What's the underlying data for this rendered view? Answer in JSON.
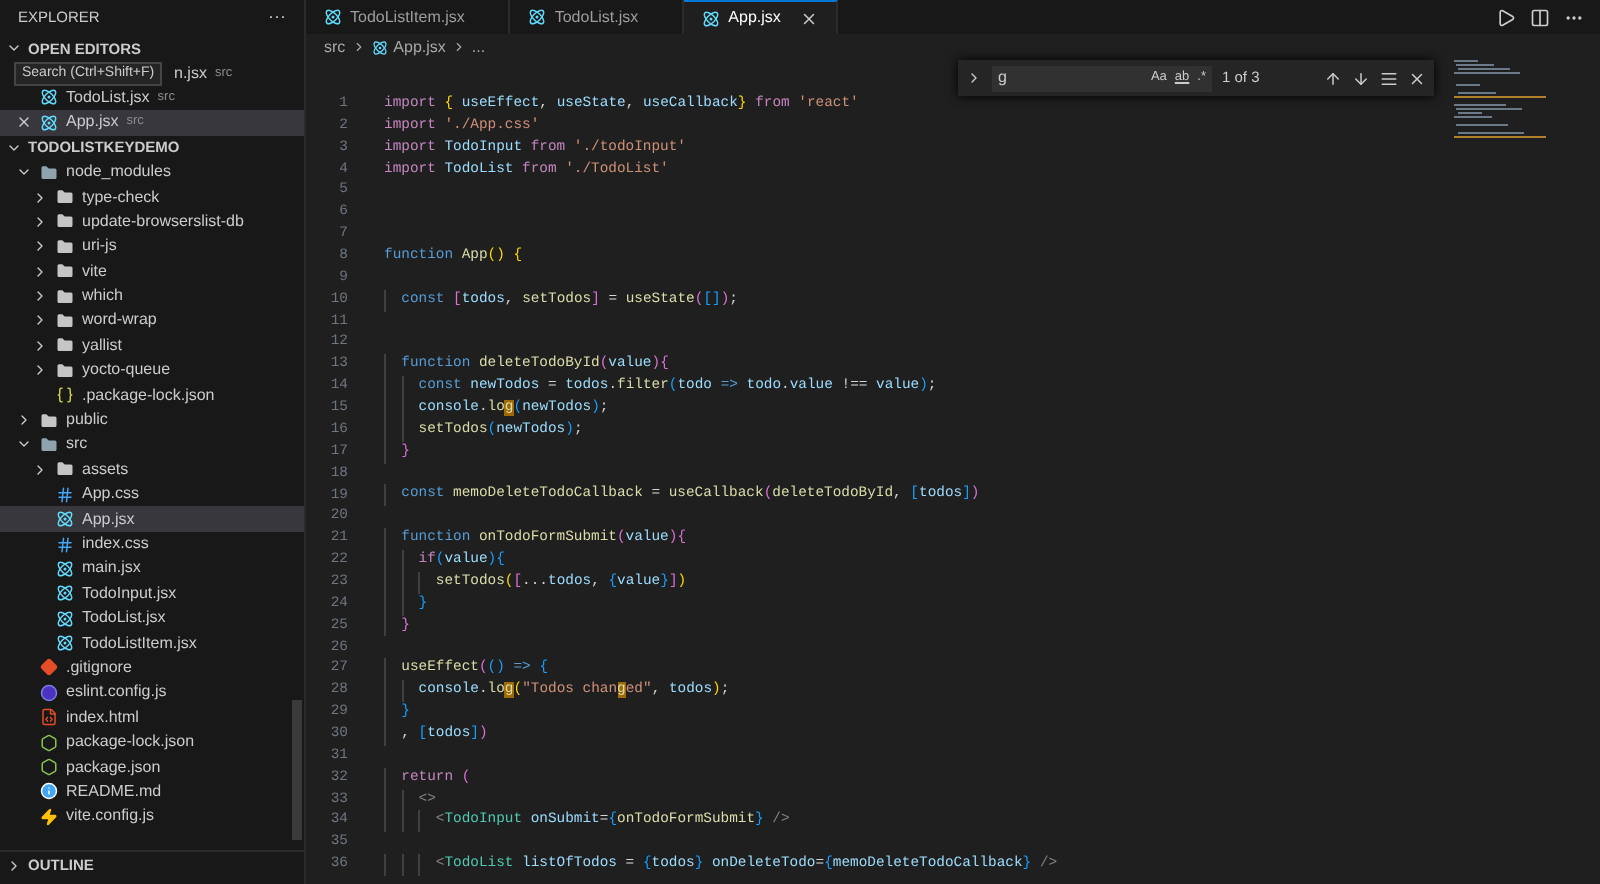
{
  "sidebar": {
    "title": "EXPLORER",
    "more": "···",
    "open_editors": {
      "title": "OPEN EDITORS",
      "expanded": true,
      "tooltip": "Search (Ctrl+Shift+F)",
      "items": [
        {
          "name": "n.jsx",
          "detail": "src",
          "selected": false,
          "partial": true
        },
        {
          "name": "TodoList.jsx",
          "detail": "src",
          "kind": "react",
          "selected": false,
          "partial": false
        },
        {
          "name": "App.jsx",
          "detail": "src",
          "kind": "react",
          "selected": true,
          "partial": false
        }
      ]
    },
    "project": {
      "title": "TODOLISTKEYDEMO",
      "expanded": true,
      "items": [
        {
          "name": "node_modules",
          "kind": "folder",
          "expanded": true,
          "selected": false,
          "children": [
            {
              "name": "type-check",
              "kind": "folder",
              "expanded": false,
              "selected": false
            },
            {
              "name": "update-browserslist-db",
              "kind": "folder",
              "expanded": false,
              "selected": false
            },
            {
              "name": "uri-js",
              "kind": "folder",
              "expanded": false,
              "selected": false
            },
            {
              "name": "vite",
              "kind": "folder",
              "expanded": false,
              "selected": false
            },
            {
              "name": "which",
              "kind": "folder",
              "expanded": false,
              "selected": false
            },
            {
              "name": "word-wrap",
              "kind": "folder",
              "expanded": false,
              "selected": false
            },
            {
              "name": "yallist",
              "kind": "folder",
              "expanded": false,
              "selected": false
            },
            {
              "name": "yocto-queue",
              "kind": "folder",
              "expanded": false,
              "selected": false
            },
            {
              "name": ".package-lock.json",
              "kind": "json",
              "selected": false
            }
          ]
        },
        {
          "name": "public",
          "kind": "folder",
          "expanded": false,
          "selected": false
        },
        {
          "name": "src",
          "kind": "folder",
          "expanded": true,
          "selected": false,
          "children": [
            {
              "name": "assets",
              "kind": "folder",
              "expanded": false,
              "selected": false
            },
            {
              "name": "App.css",
              "kind": "css",
              "selected": false
            },
            {
              "name": "App.jsx",
              "kind": "react",
              "selected": true
            },
            {
              "name": "index.css",
              "kind": "css",
              "selected": false
            },
            {
              "name": "main.jsx",
              "kind": "react",
              "selected": false
            },
            {
              "name": "TodoInput.jsx",
              "kind": "react",
              "selected": false
            },
            {
              "name": "TodoList.jsx",
              "kind": "react",
              "selected": false
            },
            {
              "name": "TodoListItem.jsx",
              "kind": "react",
              "selected": false
            }
          ]
        },
        {
          "name": ".gitignore",
          "kind": "git",
          "selected": false
        },
        {
          "name": "eslint.config.js",
          "kind": "eslint",
          "selected": false
        },
        {
          "name": "index.html",
          "kind": "html",
          "selected": false
        },
        {
          "name": "package-lock.json",
          "kind": "npm",
          "selected": false
        },
        {
          "name": "package.json",
          "kind": "npm",
          "selected": false
        },
        {
          "name": "README.md",
          "kind": "info",
          "selected": false
        },
        {
          "name": "vite.config.js",
          "kind": "vite",
          "selected": false
        }
      ]
    },
    "outline": {
      "title": "OUTLINE",
      "expanded": false
    }
  },
  "tabs": [
    {
      "label": "TodoListItem.jsx",
      "selected": false
    },
    {
      "label": "TodoList.jsx",
      "selected": false
    },
    {
      "label": "App.jsx",
      "selected": true
    }
  ],
  "breadcrumb": [
    "src",
    "App.jsx",
    "..."
  ],
  "find": {
    "value": "g",
    "options": [
      "Aa",
      "ab",
      ".*"
    ],
    "result": "1 of 3"
  },
  "code": [
    {
      "number": "1",
      "tokens": [
        {
          "text": "import ",
          "kind": "kw"
        },
        {
          "text": "{",
          "kind": "b1"
        },
        {
          "text": " useEffect",
          "kind": "var"
        },
        {
          "text": ", ",
          "kind": "p"
        },
        {
          "text": "useState",
          "kind": "var"
        },
        {
          "text": ", ",
          "kind": "p"
        },
        {
          "text": "useCallback",
          "kind": "var"
        },
        {
          "text": "} ",
          "kind": "b1"
        },
        {
          "text": "from ",
          "kind": "kw"
        },
        {
          "text": "'react'",
          "kind": "str"
        }
      ]
    },
    {
      "number": "2",
      "tokens": [
        {
          "text": "import ",
          "kind": "kw"
        },
        {
          "text": "'./App.css'",
          "kind": "str"
        }
      ]
    },
    {
      "number": "3",
      "tokens": [
        {
          "text": "import ",
          "kind": "kw"
        },
        {
          "text": "TodoInput ",
          "kind": "var"
        },
        {
          "text": "from ",
          "kind": "kw"
        },
        {
          "text": "'./todoInput'",
          "kind": "str"
        }
      ]
    },
    {
      "number": "4",
      "tokens": [
        {
          "text": "import ",
          "kind": "kw"
        },
        {
          "text": "TodoList ",
          "kind": "var"
        },
        {
          "text": "from ",
          "kind": "kw"
        },
        {
          "text": "'./TodoList'",
          "kind": "str"
        }
      ]
    },
    {
      "number": "5"
    },
    {
      "number": "6"
    },
    {
      "number": "7"
    },
    {
      "number": "8",
      "tokens": [
        {
          "text": "function ",
          "kind": "st"
        },
        {
          "text": "App",
          "kind": "fn"
        },
        {
          "text": "() {",
          "kind": "b1"
        }
      ]
    },
    {
      "number": "9"
    },
    {
      "number": "10",
      "tokens": [
        {
          "text": "  const ",
          "kind": "st"
        },
        {
          "text": "[",
          "kind": "b2"
        },
        {
          "text": "todos",
          "kind": "var"
        },
        {
          "text": ", ",
          "kind": "p"
        },
        {
          "text": "setTodos",
          "kind": "fn"
        },
        {
          "text": "]",
          "kind": "b2"
        },
        {
          "text": " = ",
          "kind": "p"
        },
        {
          "text": "useState",
          "kind": "fn"
        },
        {
          "text": "(",
          "kind": "b2"
        },
        {
          "text": "[]",
          "kind": "b3"
        },
        {
          "text": ")",
          "kind": "b2"
        },
        {
          "text": ";",
          "kind": "p"
        }
      ]
    },
    {
      "number": "11"
    },
    {
      "number": "12"
    },
    {
      "number": "13",
      "tokens": [
        {
          "text": "  function ",
          "kind": "st"
        },
        {
          "text": "deleteTodoById",
          "kind": "fn"
        },
        {
          "text": "(",
          "kind": "b2"
        },
        {
          "text": "value",
          "kind": "var"
        },
        {
          "text": ")",
          "kind": "b2"
        },
        {
          "text": "{",
          "kind": "b2"
        }
      ]
    },
    {
      "number": "14",
      "tokens": [
        {
          "text": "    const ",
          "kind": "st"
        },
        {
          "text": "newTodos",
          "kind": "var"
        },
        {
          "text": " = ",
          "kind": "p"
        },
        {
          "text": "todos",
          "kind": "var"
        },
        {
          "text": ".",
          "kind": "p"
        },
        {
          "text": "filter",
          "kind": "fn"
        },
        {
          "text": "(",
          "kind": "b3"
        },
        {
          "text": "todo ",
          "kind": "var"
        },
        {
          "text": "=> ",
          "kind": "st"
        },
        {
          "text": "todo",
          "kind": "var"
        },
        {
          "text": ".",
          "kind": "p"
        },
        {
          "text": "value",
          "kind": "var"
        },
        {
          "text": " !== ",
          "kind": "p"
        },
        {
          "text": "value",
          "kind": "var"
        },
        {
          "text": ")",
          "kind": "b3"
        },
        {
          "text": ";",
          "kind": "p"
        }
      ]
    },
    {
      "number": "15",
      "tokens": [
        {
          "text": "    console",
          "kind": "var"
        },
        {
          "text": ".",
          "kind": "p"
        },
        {
          "text": "lo",
          "kind": "fn"
        },
        {
          "text": "g",
          "kind": "match"
        },
        {
          "text": "(",
          "kind": "b3"
        },
        {
          "text": "newTodos",
          "kind": "var"
        },
        {
          "text": ")",
          "kind": "b3"
        },
        {
          "text": ";",
          "kind": "p"
        }
      ]
    },
    {
      "number": "16",
      "tokens": [
        {
          "text": "    setTodos",
          "kind": "fn"
        },
        {
          "text": "(",
          "kind": "b3"
        },
        {
          "text": "newTodos",
          "kind": "var"
        },
        {
          "text": ")",
          "kind": "b3"
        },
        {
          "text": ";",
          "kind": "p"
        }
      ]
    },
    {
      "number": "17",
      "tokens": [
        {
          "text": "  }",
          "kind": "b2"
        }
      ]
    },
    {
      "number": "18"
    },
    {
      "number": "19",
      "tokens": [
        {
          "text": "  const ",
          "kind": "st"
        },
        {
          "text": "memoDeleteTodoCallback",
          "kind": "fn"
        },
        {
          "text": " = ",
          "kind": "p"
        },
        {
          "text": "useCallback",
          "kind": "fn"
        },
        {
          "text": "(",
          "kind": "b2"
        },
        {
          "text": "deleteTodoById",
          "kind": "fn"
        },
        {
          "text": ", ",
          "kind": "p"
        },
        {
          "text": "[",
          "kind": "b3"
        },
        {
          "text": "todos",
          "kind": "var"
        },
        {
          "text": "]",
          "kind": "b3"
        },
        {
          "text": ")",
          "kind": "b2"
        }
      ]
    },
    {
      "number": "20"
    },
    {
      "number": "21",
      "tokens": [
        {
          "text": "  function ",
          "kind": "st"
        },
        {
          "text": "onTodoFormSubmit",
          "kind": "fn"
        },
        {
          "text": "(",
          "kind": "b2"
        },
        {
          "text": "value",
          "kind": "var"
        },
        {
          "text": ")",
          "kind": "b2"
        },
        {
          "text": "{",
          "kind": "b2"
        }
      ]
    },
    {
      "number": "22",
      "tokens": [
        {
          "text": "    if",
          "kind": "kw"
        },
        {
          "text": "(",
          "kind": "b3"
        },
        {
          "text": "value",
          "kind": "var"
        },
        {
          "text": ")",
          "kind": "b3"
        },
        {
          "text": "{",
          "kind": "b3"
        }
      ]
    },
    {
      "number": "23",
      "tokens": [
        {
          "text": "      setTodos",
          "kind": "fn"
        },
        {
          "text": "(",
          "kind": "b1"
        },
        {
          "text": "[",
          "kind": "b2"
        },
        {
          "text": "...",
          "kind": "p"
        },
        {
          "text": "todos",
          "kind": "var"
        },
        {
          "text": ", ",
          "kind": "p"
        },
        {
          "text": "{",
          "kind": "b3"
        },
        {
          "text": "value",
          "kind": "var"
        },
        {
          "text": "}",
          "kind": "b3"
        },
        {
          "text": "]",
          "kind": "b2"
        },
        {
          "text": ")",
          "kind": "b1"
        }
      ]
    },
    {
      "number": "24",
      "tokens": [
        {
          "text": "    }",
          "kind": "b3"
        }
      ]
    },
    {
      "number": "25",
      "tokens": [
        {
          "text": "  }",
          "kind": "b2"
        }
      ]
    },
    {
      "number": "26"
    },
    {
      "number": "27",
      "tokens": [
        {
          "text": "  useEffect",
          "kind": "fn"
        },
        {
          "text": "(",
          "kind": "b2"
        },
        {
          "text": "() ",
          "kind": "b3"
        },
        {
          "text": "=> ",
          "kind": "st"
        },
        {
          "text": "{",
          "kind": "b3"
        }
      ]
    },
    {
      "number": "28",
      "tokens": [
        {
          "text": "    console",
          "kind": "var"
        },
        {
          "text": ".",
          "kind": "p"
        },
        {
          "text": "lo",
          "kind": "fn"
        },
        {
          "text": "g",
          "kind": "match"
        },
        {
          "text": "(",
          "kind": "b1"
        },
        {
          "text": "\"Todos chan",
          "kind": "str"
        },
        {
          "text": "g",
          "kind": "match"
        },
        {
          "text": "ed\"",
          "kind": "str"
        },
        {
          "text": ", ",
          "kind": "p"
        },
        {
          "text": "todos",
          "kind": "var"
        },
        {
          "text": ")",
          "kind": "b1"
        },
        {
          "text": ";",
          "kind": "p"
        }
      ]
    },
    {
      "number": "29",
      "tokens": [
        {
          "text": "  }",
          "kind": "b3"
        }
      ]
    },
    {
      "number": "30",
      "tokens": [
        {
          "text": "  , ",
          "kind": "p"
        },
        {
          "text": "[",
          "kind": "b3"
        },
        {
          "text": "todos",
          "kind": "var"
        },
        {
          "text": "]",
          "kind": "b3"
        },
        {
          "text": ")",
          "kind": "b2"
        }
      ]
    },
    {
      "number": "31"
    },
    {
      "number": "32",
      "tokens": [
        {
          "text": "  return ",
          "kind": "kw"
        },
        {
          "text": "(",
          "kind": "b2"
        }
      ]
    },
    {
      "number": "33",
      "tokens": [
        {
          "text": "    <>",
          "kind": "tagp"
        }
      ]
    },
    {
      "number": "34",
      "tokens": [
        {
          "text": "      <",
          "kind": "tagp"
        },
        {
          "text": "TodoInput ",
          "kind": "tag"
        },
        {
          "text": "onSubmit",
          "kind": "var"
        },
        {
          "text": "=",
          "kind": "p"
        },
        {
          "text": "{",
          "kind": "b3"
        },
        {
          "text": "onTodoFormSubmit",
          "kind": "fn"
        },
        {
          "text": "} ",
          "kind": "b3"
        },
        {
          "text": "/>",
          "kind": "tagp"
        }
      ]
    },
    {
      "number": "35"
    },
    {
      "number": "36",
      "tokens": [
        {
          "text": "      <",
          "kind": "tagp"
        },
        {
          "text": "TodoList ",
          "kind": "tag"
        },
        {
          "text": "listOfTodos",
          "kind": "var"
        },
        {
          "text": " = ",
          "kind": "p"
        },
        {
          "text": "{",
          "kind": "b3"
        },
        {
          "text": "todos",
          "kind": "var"
        },
        {
          "text": "} ",
          "kind": "b3"
        },
        {
          "text": "onDeleteTodo",
          "kind": "var"
        },
        {
          "text": "=",
          "kind": "p"
        },
        {
          "text": "{",
          "kind": "b3"
        },
        {
          "text": "memoDeleteTodoCallback",
          "kind": "var"
        },
        {
          "text": "} ",
          "kind": "b3"
        },
        {
          "text": "/>",
          "kind": "tagp"
        }
      ]
    }
  ]
}
